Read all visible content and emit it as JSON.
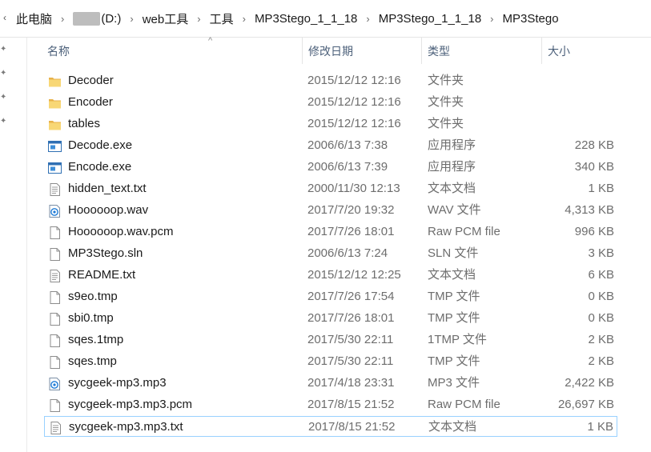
{
  "address": {
    "crumbs": [
      "此电脑",
      "(D:)",
      "web工具",
      "工具",
      "MP3Stego_1_1_18",
      "MP3Stego_1_1_18",
      "MP3Stego"
    ]
  },
  "columns": {
    "name": "名称",
    "modified": "修改日期",
    "type": "类型",
    "size": "大小"
  },
  "files": [
    {
      "name": "Decoder",
      "modified": "2015/12/12 12:16",
      "type": "文件夹",
      "size": "",
      "icon": "folder-icon"
    },
    {
      "name": "Encoder",
      "modified": "2015/12/12 12:16",
      "type": "文件夹",
      "size": "",
      "icon": "folder-icon"
    },
    {
      "name": "tables",
      "modified": "2015/12/12 12:16",
      "type": "文件夹",
      "size": "",
      "icon": "folder-icon"
    },
    {
      "name": "Decode.exe",
      "modified": "2006/6/13 7:38",
      "type": "应用程序",
      "size": "228 KB",
      "icon": "exe-icon"
    },
    {
      "name": "Encode.exe",
      "modified": "2006/6/13 7:39",
      "type": "应用程序",
      "size": "340 KB",
      "icon": "exe-icon"
    },
    {
      "name": "hidden_text.txt",
      "modified": "2000/11/30 12:13",
      "type": "文本文档",
      "size": "1 KB",
      "icon": "text-file-icon"
    },
    {
      "name": "Hoooooop.wav",
      "modified": "2017/7/20 19:32",
      "type": "WAV 文件",
      "size": "4,313 KB",
      "icon": "audio-file-icon"
    },
    {
      "name": "Hoooooop.wav.pcm",
      "modified": "2017/7/26 18:01",
      "type": "Raw PCM file",
      "size": "996 KB",
      "icon": "blank-file-icon"
    },
    {
      "name": "MP3Stego.sln",
      "modified": "2006/6/13 7:24",
      "type": "SLN 文件",
      "size": "3 KB",
      "icon": "blank-file-icon"
    },
    {
      "name": "README.txt",
      "modified": "2015/12/12 12:25",
      "type": "文本文档",
      "size": "6 KB",
      "icon": "text-file-icon"
    },
    {
      "name": "s9eo.tmp",
      "modified": "2017/7/26 17:54",
      "type": "TMP 文件",
      "size": "0 KB",
      "icon": "blank-file-icon"
    },
    {
      "name": "sbi0.tmp",
      "modified": "2017/7/26 18:01",
      "type": "TMP 文件",
      "size": "0 KB",
      "icon": "blank-file-icon"
    },
    {
      "name": "sqes.1tmp",
      "modified": "2017/5/30 22:11",
      "type": "1TMP 文件",
      "size": "2 KB",
      "icon": "blank-file-icon"
    },
    {
      "name": "sqes.tmp",
      "modified": "2017/5/30 22:11",
      "type": "TMP 文件",
      "size": "2 KB",
      "icon": "blank-file-icon"
    },
    {
      "name": "sycgeek-mp3.mp3",
      "modified": "2017/4/18 23:31",
      "type": "MP3 文件",
      "size": "2,422 KB",
      "icon": "audio-file-icon"
    },
    {
      "name": "sycgeek-mp3.mp3.pcm",
      "modified": "2017/8/15 21:52",
      "type": "Raw PCM file",
      "size": "26,697 KB",
      "icon": "blank-file-icon"
    },
    {
      "name": "sycgeek-mp3.mp3.txt",
      "modified": "2017/8/15 21:52",
      "type": "文本文档",
      "size": "1 KB",
      "icon": "text-file-icon",
      "selected": true
    }
  ]
}
